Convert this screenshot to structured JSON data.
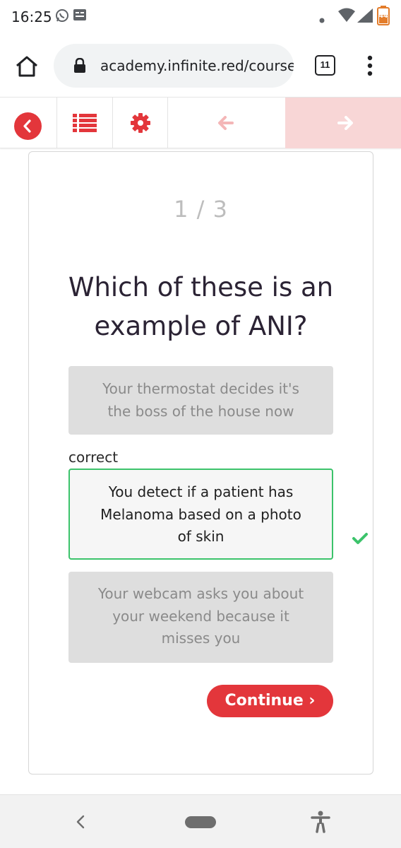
{
  "status_bar": {
    "time": "16:25",
    "icons": [
      "whatsapp-icon",
      "gboard-icon",
      "dot-icon",
      "wifi-icon",
      "signal-icon",
      "battery-icon"
    ],
    "battery_text": "44"
  },
  "browser": {
    "url": "academy.infinite.red/courses",
    "tab_count": "11",
    "icons": [
      "home-icon",
      "lock-icon",
      "menu-icon"
    ]
  },
  "toolbar": {
    "buttons": [
      "back-button",
      "lesson-list-button",
      "settings-button",
      "previous-button",
      "next-button"
    ],
    "accent": "#e3363b",
    "next_bg": "#f8d6d6"
  },
  "quiz": {
    "progress": "1 / 3",
    "question": "Which of these is an example of ANI?",
    "correct_label": "correct",
    "answers": [
      {
        "text": "Your thermostat decides it's the boss of the house now",
        "state": "incorrect"
      },
      {
        "text": "You detect if a patient has Melanoma based on a photo of skin",
        "state": "correct"
      },
      {
        "text": "Your webcam asks you about your weekend because it misses you",
        "state": "incorrect"
      }
    ],
    "continue_label": "Continue ›",
    "correct_color": "#3cc36b"
  },
  "nav_bar": {
    "icons": [
      "nav-back-icon",
      "nav-home-pill",
      "accessibility-icon"
    ]
  }
}
